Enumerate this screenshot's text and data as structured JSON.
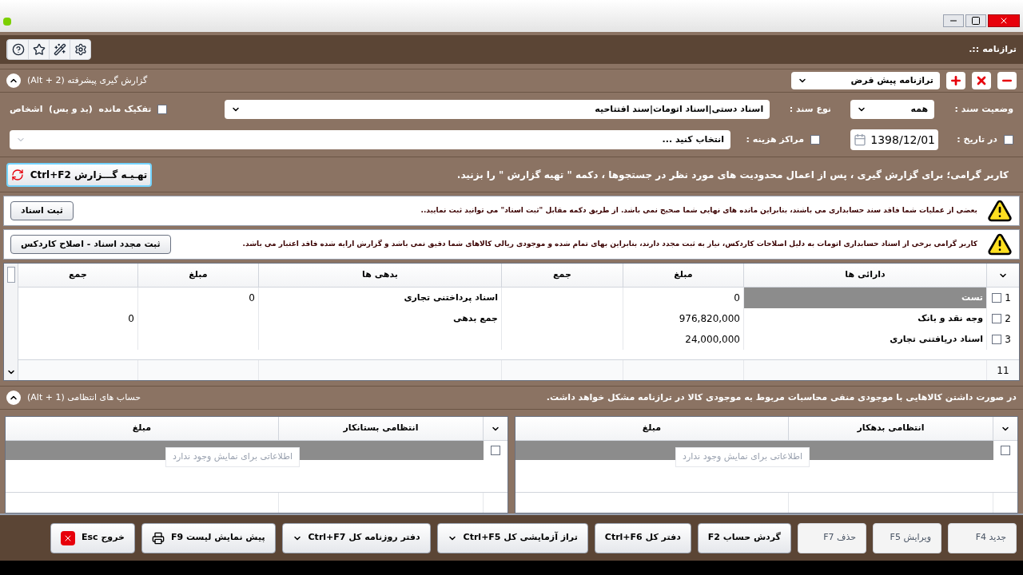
{
  "window": {
    "marker": ".::",
    "title": "ترازنامه"
  },
  "report": {
    "title": "گزارش گیری پیشرفته (Alt + 2)",
    "expanded": true,
    "preset": "ترازنامه پیش فرض"
  },
  "filters": {
    "status_label": "وضعیت سند :",
    "status_value": "همه",
    "doc_type_label": "نوع سند :",
    "doc_type_value": "اسناد دستی|اسناد اتومات|سند افتتاحیه",
    "separate_balance": {
      "label": "تفکیک مانده  (بد و بس)  اشخاص",
      "checked": false
    },
    "date": {
      "label": "در تاریخ :",
      "checked": false,
      "value": "1398/12/01"
    },
    "cost_centers": {
      "label": "مراکز هزینه :",
      "checked": false,
      "value": "انتخاب کنید ..."
    }
  },
  "hint": {
    "text": "کاربر گرامی؛ برای گزارش گیری ، پس از اعمال محدودیت های مورد نظر در جستجوها ، دکمه \" تهیه گزارش \" را بزنید.",
    "button": "تهـیـه گـــزارش Ctrl+F2"
  },
  "alerts": [
    {
      "text": "بعضی از عملیات شما فاقد سند حسابداری می باشند، بنابراین مانده های نهایی شما صحیح نمی باشد. از طریق دکمه مقابل \"ثبت اسناد\" می توانید ثبت نمایید..",
      "button": "ثبت اسناد"
    },
    {
      "text": "کاربر گرامی برخی از اسناد حسابداری اتومات به دلیل اصلاحات کاردکس، نیاز به ثبت مجدد دارند، بنابراین بهای تمام شده و موجودی ریالی کالاهای شما دقیق نمی باشد و گزارش ارایه شده فاقد اعتبار می باشد.",
      "button": "ثبت مجدد اسناد - اصلاح کاردکس"
    }
  ],
  "table": {
    "columns": [
      "دارائی ها",
      "مبلغ",
      "جمع",
      "بدهی ها",
      "مبلغ",
      "جمع"
    ],
    "rows": [
      {
        "number": "1",
        "checked": false,
        "selected": true,
        "cells": [
          "تست",
          "0",
          "",
          "اسناد پرداختنی تجاری",
          "0",
          ""
        ]
      },
      {
        "number": "2",
        "checked": false,
        "selected": false,
        "cells": [
          "وجه نقد و بانک",
          "976,820,000",
          "",
          "جمع بدهی",
          "",
          "0"
        ]
      },
      {
        "number": "3",
        "checked": false,
        "selected": false,
        "cells": [
          "اسناد دریافتنی تجاری",
          "24,000,000",
          "",
          "",
          "",
          ""
        ]
      }
    ],
    "footer": "11"
  },
  "memo": {
    "title": "حساب های انتظامی (Alt + 1)",
    "expanded": true,
    "note": "در صورت داشتن کالاهایی با موجودی منفی محاسبات مربوط به موجودی کالا در ترازنامه مشکل خواهد داشت.",
    "grids": [
      {
        "columns": [
          "انتظامی بدهکار",
          "مبلغ"
        ],
        "checked": false,
        "empty": "اطلاعاتی برای نمایش وجود ندارد"
      },
      {
        "columns": [
          "انتظامی بستانکار",
          "مبلغ"
        ],
        "checked": false,
        "empty": "اطلاعاتی برای نمایش وجود ندارد"
      }
    ]
  },
  "toolbar": [
    {
      "label": "جدید F4",
      "kind": "plain",
      "disabled": true
    },
    {
      "label": "ویرایش F5",
      "kind": "plain",
      "disabled": true
    },
    {
      "label": "حذف F7",
      "kind": "plain",
      "disabled": true
    },
    {
      "label": "گردش حساب F2",
      "kind": "plain",
      "disabled": false
    },
    {
      "label": "دفتر کل Ctrl+F6",
      "kind": "plain",
      "disabled": false
    },
    {
      "label": "تراز آزمایشی کل Ctrl+F5",
      "kind": "dropdown",
      "disabled": false
    },
    {
      "label": "دفتر روزنامه کل Ctrl+F7",
      "kind": "dropdown",
      "disabled": false
    },
    {
      "label": "پیش نمایش لیست F9",
      "kind": "print",
      "disabled": false
    },
    {
      "label": "خروج Esc",
      "kind": "exit",
      "disabled": false
    }
  ]
}
